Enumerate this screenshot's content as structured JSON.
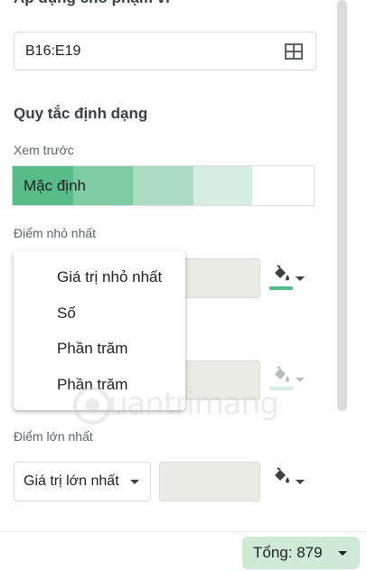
{
  "panel": {
    "clipped_title": "Áp dụng cho phạm vi",
    "range": {
      "value": "B16:E19"
    },
    "rules_title": "Quy tắc định dạng",
    "preview_label": "Xem trước",
    "preview_text": "Mặc định",
    "min_point_label": "Điểm nhỏ nhất",
    "max_point_label": "Điểm lớn nhất",
    "max_select_value": "Giá trị lớn nhất"
  },
  "menu": {
    "items": [
      {
        "label": "Giá trị nhỏ nhất"
      },
      {
        "label": "Số"
      },
      {
        "label": "Phần trăm"
      },
      {
        "label": "Phần trăm"
      }
    ]
  },
  "status_bar": {
    "total": "Tổng: 879"
  },
  "colors": {
    "preview_gradient": [
      "#57bb8a",
      "#7fcba4",
      "#abdcc2",
      "#d5eee1",
      "#ffffff"
    ],
    "min_color": "#57bb8a",
    "mid_color": "#d5eee1",
    "max_color": "#ffffff",
    "chip_bg": "#ceead6"
  },
  "watermark": {
    "text": "uantrimang"
  },
  "icons": {
    "range_selector": "grid-icon",
    "fill_color": "paint-bucket-icon",
    "dropdown": "chevron-down-icon"
  }
}
